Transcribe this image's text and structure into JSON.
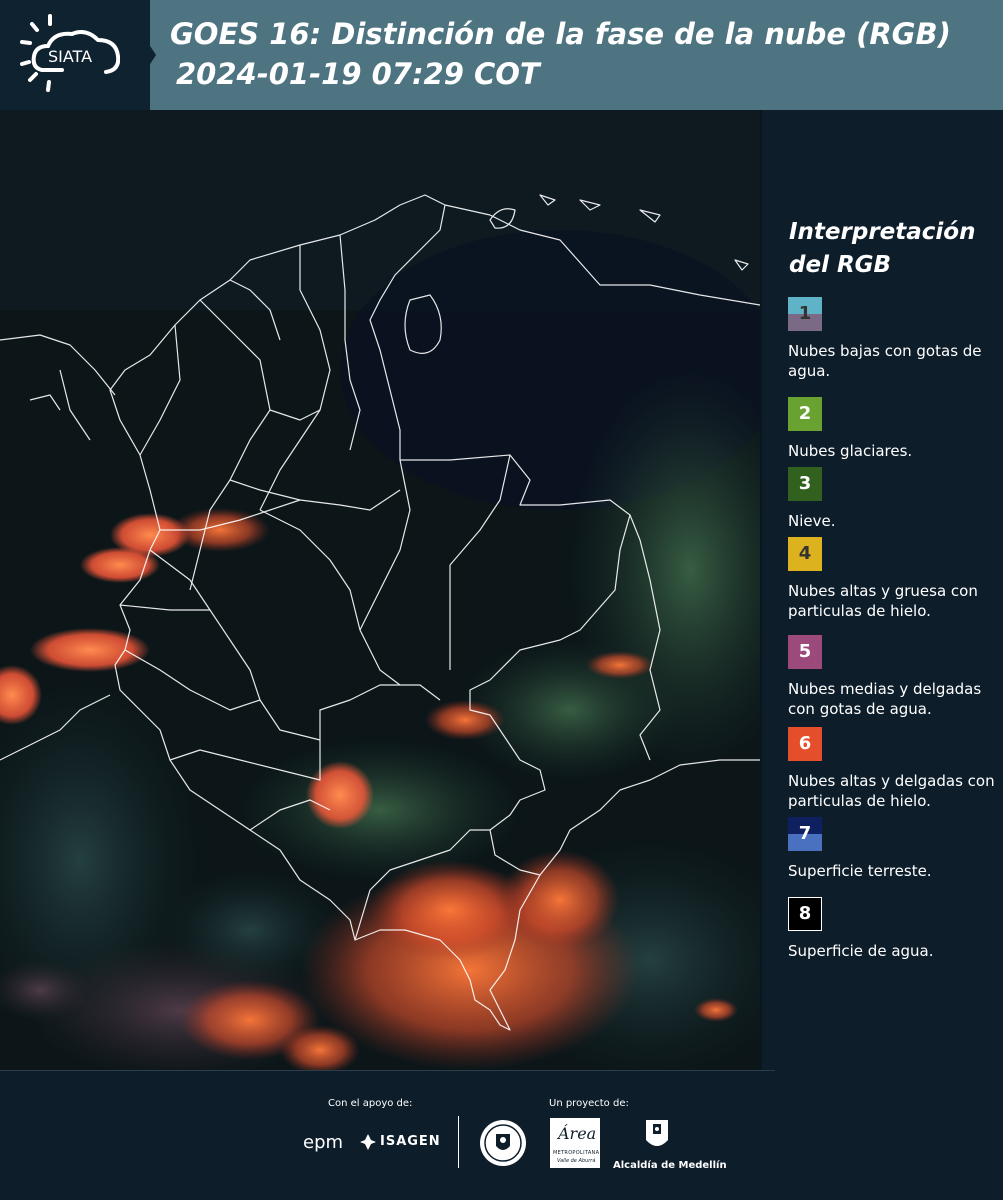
{
  "header": {
    "logo_text": "SIATA",
    "title": "GOES 16: Distinción de la fase de la nube (RGB)",
    "datetime": "2024-01-19 07:29 COT"
  },
  "legend": {
    "title": "Interpretación del RGB",
    "items": [
      {
        "number": "1",
        "label": "Nubes bajas con gotas de agua.",
        "color_top": "#5eb4c6",
        "color_bottom": "#7a6a86",
        "text_color": "#333333"
      },
      {
        "number": "2",
        "label": "Nubes glaciares.",
        "color": "#6aa231",
        "text_color": "#ffffff"
      },
      {
        "number": "3",
        "label": "Nieve.",
        "color": "#32601f",
        "text_color": "#ffffff"
      },
      {
        "number": "4",
        "label": "Nubes altas y gruesa con particulas de hielo.",
        "color": "#dcb21e",
        "text_color": "#333333"
      },
      {
        "number": "5",
        "label": "Nubes medias y delgadas con gotas de agua.",
        "color": "#9c4a7c",
        "text_color": "#ffffff"
      },
      {
        "number": "6",
        "label": "Nubes altas y delgadas con particulas de hielo.",
        "color": "#e54e2a",
        "text_color": "#ffffff"
      },
      {
        "number": "7",
        "label": "Superficie terreste.",
        "color_top": "#0e2060",
        "color_bottom": "#4a70c0",
        "text_color": "#ffffff"
      },
      {
        "number": "8",
        "label": "Superficie de agua.",
        "color": "#000000",
        "text_color": "#ffffff"
      }
    ]
  },
  "footer": {
    "support_label": "Con el apoyo de:",
    "project_label": "Un proyecto de:",
    "sponsor_epm": "epm",
    "sponsor_isagen": "ISAGEN",
    "partner_area": "Área",
    "partner_area_sub": "METROPOLITANA",
    "partner_area_sub2": "Valle de Aburrá",
    "partner_medellin": "Alcaldía de Medellín"
  }
}
